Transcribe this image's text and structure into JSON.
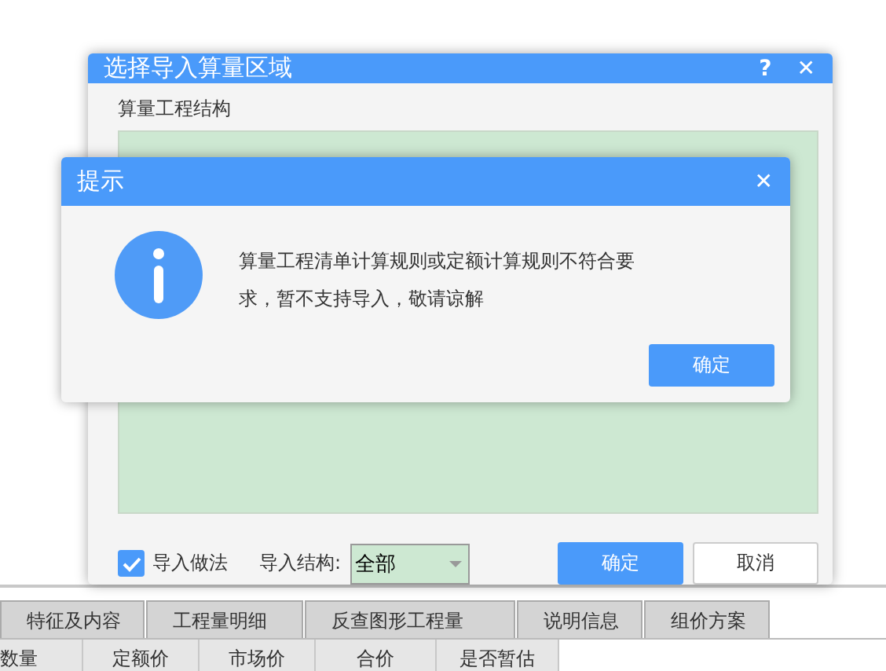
{
  "background": {
    "tabs": [
      {
        "label": "特征及内容",
        "selected": false
      },
      {
        "label": "工程量明细",
        "selected": false
      },
      {
        "label": "反查图形工程量",
        "selected": false
      },
      {
        "label": "说明信息",
        "selected": false
      },
      {
        "label": "组价方案",
        "selected": false
      }
    ],
    "columns": [
      "数量",
      "定额价",
      "市场价",
      "合价",
      "是否暂估"
    ]
  },
  "dialog": {
    "title": "选择导入算量区域",
    "help": "?",
    "close": "✕",
    "section_label": "算量工程结构",
    "import_method": {
      "label": "导入做法",
      "checked": true
    },
    "structure": {
      "label": "导入结构:",
      "value": "全部"
    },
    "buttons": [
      {
        "label": "确定",
        "kind": "primary"
      },
      {
        "label": "取消",
        "kind": "secondary"
      }
    ]
  },
  "alert": {
    "title": "提示",
    "close": "✕",
    "message": "算量工程清单计算规则或定额计算规则不符合要求，暂不支持导入，敬请谅解",
    "button": "确定"
  }
}
